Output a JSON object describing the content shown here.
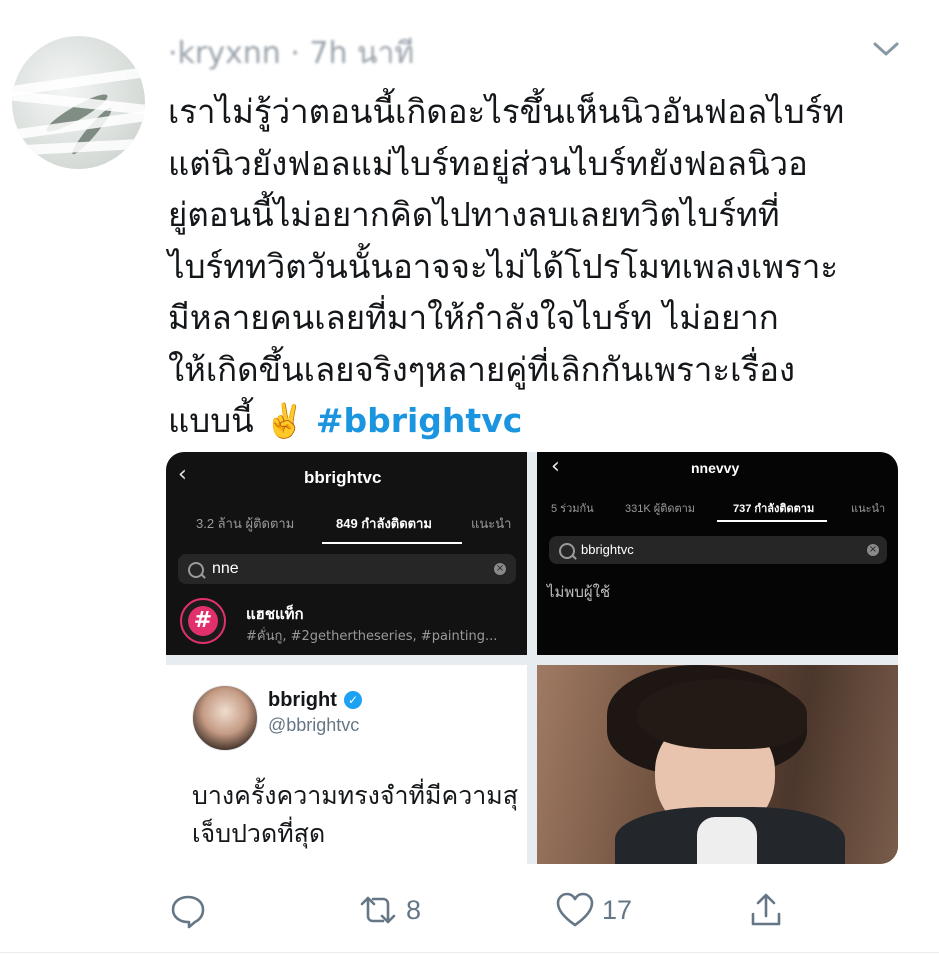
{
  "tweet": {
    "header_text": "·kryxnn · 7h นาที",
    "body_lines": [
      "เราไม่รู้ว่าตอนนี้เกิดอะไรขึ้นเห็นนิวอันฟอลไบร์ท",
      "แต่นิวยังฟอลแม่ไบร์ทอยู่ส่วนไบร์ทยังฟอลนิวอ",
      "ยู่ตอนนี้ไม่อยากคิดไปทางลบเลยทวิตไบร์ทที่",
      "ไบร์ททวิตวันนั้นอาจจะไม่ได้โปรโมทเพลงเพราะ",
      "มีหลายคนเลยที่มาให้กำลังใจไบร์ท ไม่อยาก",
      "ให้เกิดขึ้นเลยจริงๆหลายคู่ที่เลิกกันเพราะเรื่อง",
      "แบบนี้"
    ],
    "emoji": "✌️",
    "hashtag": "#bbrightvc"
  },
  "media": {
    "shot1": {
      "title": "bbrightvc",
      "tabs": [
        "3.2 ล้าน ผู้ติดตาม",
        "849 กำลังติดตาม",
        "แนะนำ"
      ],
      "search_value": "nne",
      "result_title": "แฮชแท็ก",
      "result_sub": "#คั่นกู, #2gethertheseries, #painting..."
    },
    "shot2": {
      "title": "nnevvy",
      "tabs": [
        "5 ร่วมกัน",
        "331K ผู้ติดตาม",
        "737 กำลังติดตาม",
        "แนะนำ"
      ],
      "search_value": "bbrightvc",
      "no_user": "ไม่พบผู้ใช้"
    },
    "shot3": {
      "name": "bbright",
      "handle": "@bbrightvc",
      "body_lines": [
        "บางครั้งความทรงจำที่มีความสุ",
        "เจ็บปวดที่สุด"
      ]
    }
  },
  "actions": {
    "retweets": "8",
    "likes": "17"
  },
  "colors": {
    "accent": "#1b95e0",
    "text": "#14171a",
    "muted": "#657786"
  },
  "icons": [
    "reply-icon",
    "retweet-icon",
    "like-icon",
    "share-icon",
    "chevron-down-icon",
    "verified-icon",
    "search-icon",
    "hashtag-icon"
  ]
}
